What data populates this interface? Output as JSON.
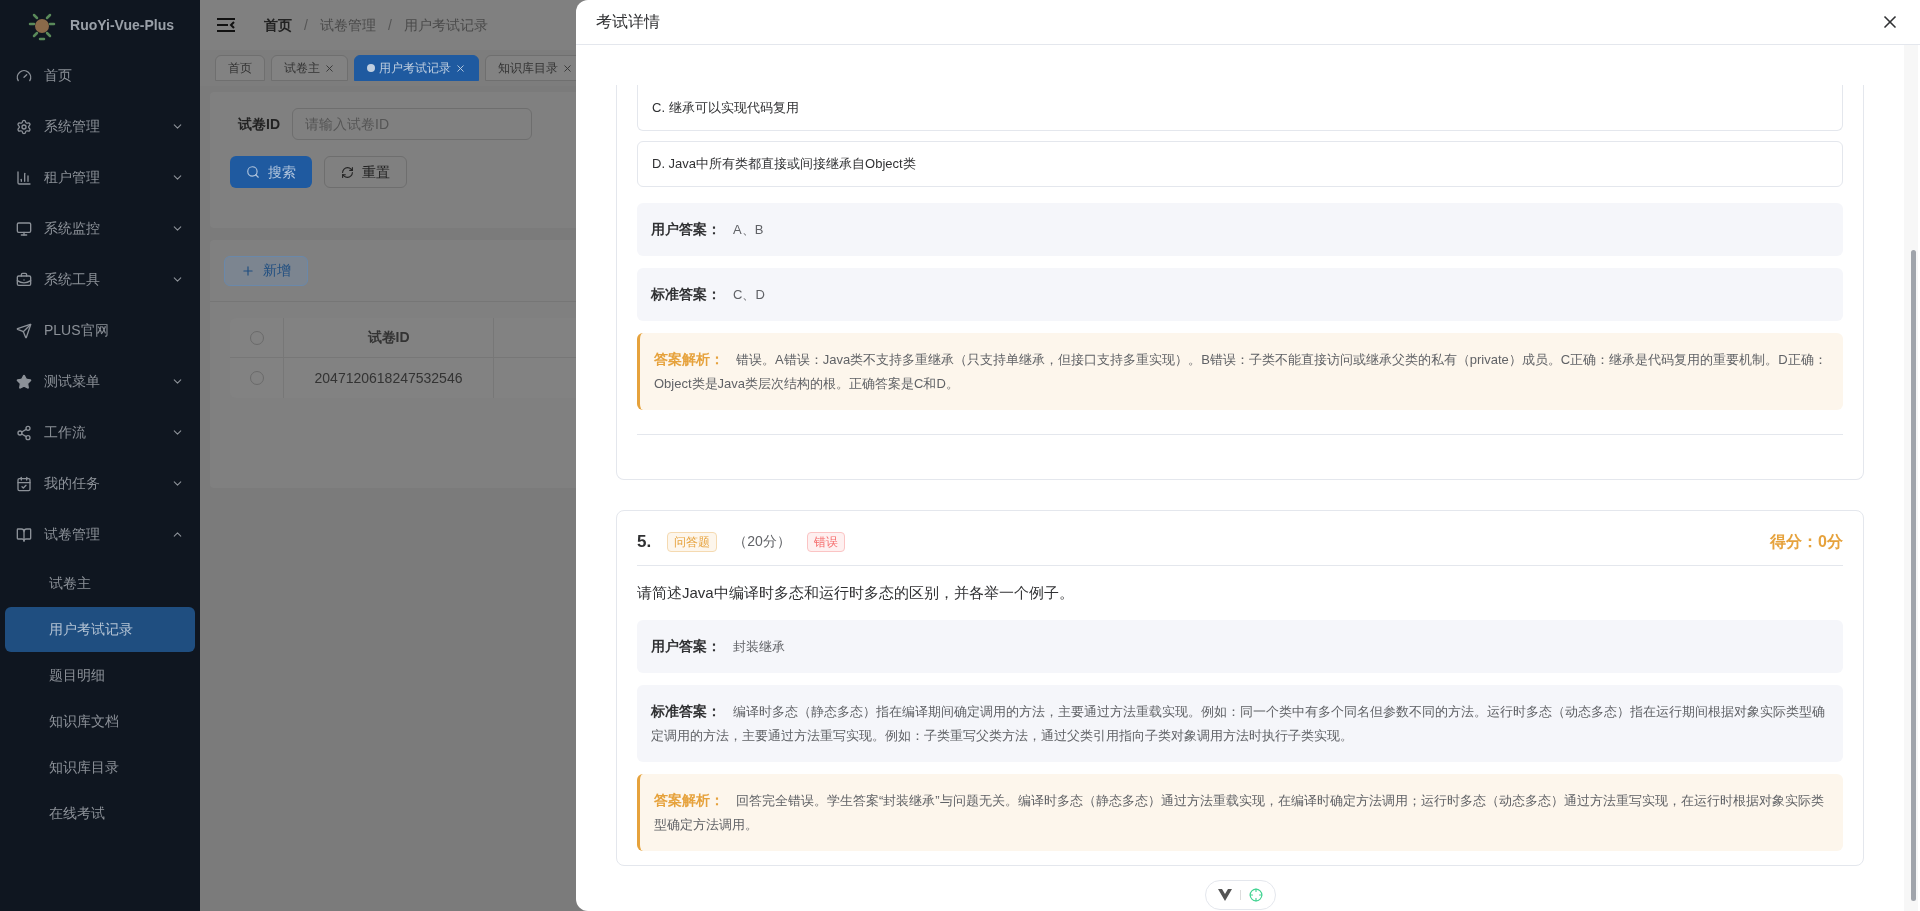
{
  "sidebar": {
    "logo_text": "RuoYi-Vue-Plus",
    "items": [
      {
        "label": "首页",
        "kind": "link"
      },
      {
        "label": "系统管理",
        "kind": "group",
        "expanded": false
      },
      {
        "label": "租户管理",
        "kind": "group",
        "expanded": false
      },
      {
        "label": "系统监控",
        "kind": "group",
        "expanded": false
      },
      {
        "label": "系统工具",
        "kind": "group",
        "expanded": false
      },
      {
        "label": "PLUS官网",
        "kind": "link"
      },
      {
        "label": "测试菜单",
        "kind": "group",
        "expanded": false
      },
      {
        "label": "工作流",
        "kind": "group",
        "expanded": false
      },
      {
        "label": "我的任务",
        "kind": "group",
        "expanded": false
      },
      {
        "label": "试卷管理",
        "kind": "group",
        "expanded": true,
        "children": [
          {
            "label": "试卷主",
            "selected": false
          },
          {
            "label": "用户考试记录",
            "selected": true
          },
          {
            "label": "题目明细",
            "selected": false
          },
          {
            "label": "知识库文档",
            "selected": false
          },
          {
            "label": "知识库目录",
            "selected": false
          },
          {
            "label": "在线考试",
            "selected": false
          }
        ]
      }
    ]
  },
  "breadcrumb": {
    "separator": "/",
    "items": [
      "首页",
      "试卷管理",
      "用户考试记录"
    ]
  },
  "tags": [
    {
      "label": "首页",
      "selected": false,
      "closable": false
    },
    {
      "label": "试卷主",
      "selected": false,
      "closable": true
    },
    {
      "label": "用户考试记录",
      "selected": true,
      "closable": true
    },
    {
      "label": "知识库目录",
      "selected": false,
      "closable": true
    }
  ],
  "search_form": {
    "label": "试卷ID",
    "placeholder": "请输入试卷ID",
    "search_button": "搜索",
    "reset_button": "重置"
  },
  "toolbar": {
    "add_button": "新增"
  },
  "table": {
    "header_checked": false,
    "columns": [
      "试卷ID"
    ],
    "rows": [
      {
        "checked": false,
        "cells": [
          "2047120618247532546"
        ]
      }
    ]
  },
  "drawer": {
    "title": "考试详情",
    "questions": [
      {
        "options": [
          "C. 继承可以实现代码复用",
          "D. Java中所有类都直接或间接继承自Object类"
        ],
        "user_answer": {
          "label": "用户答案：",
          "value": "A、B"
        },
        "standard_answer": {
          "label": "标准答案：",
          "value": "C、D"
        },
        "analysis": {
          "label": "答案解析：",
          "value": "错误。A错误：Java类不支持多重继承（只支持单继承，但接口支持多重实现）。B错误：子类不能直接访问或继承父类的私有（private）成员。C正确：继承是代码复用的重要机制。D正确：Object类是Java类层次结构的根。正确答案是C和D。"
        }
      },
      {
        "number": "5.",
        "type_tag": "问答题",
        "points": "（20分）",
        "result_tag": "错误",
        "correct": false,
        "score": "得分：0分",
        "text": "请简述Java中编译时多态和运行时多态的区别，并各举一个例子。",
        "user_answer": {
          "label": "用户答案：",
          "value": "封装继承"
        },
        "standard_answer": {
          "label": "标准答案：",
          "value": "编译时多态（静态多态）指在编译期间确定调用的方法，主要通过方法重载实现。例如：同一个类中有多个同名但参数不同的方法。运行时多态（动态多态）指在运行期间根据对象实际类型确定调用的方法，主要通过方法重写实现。例如：子类重写父类方法，通过父类引用指向子类对象调用方法时执行子类实现。"
        },
        "analysis": {
          "label": "答案解析：",
          "value": "回答完全错误。学生答案“封装继承”与问题无关。编译时多态（静态多态）通过方法重载实现，在编译时确定方法调用；运行时多态（动态多态）通过方法重写实现，在运行时根据对象实际类型确定方法调用。"
        }
      }
    ]
  }
}
